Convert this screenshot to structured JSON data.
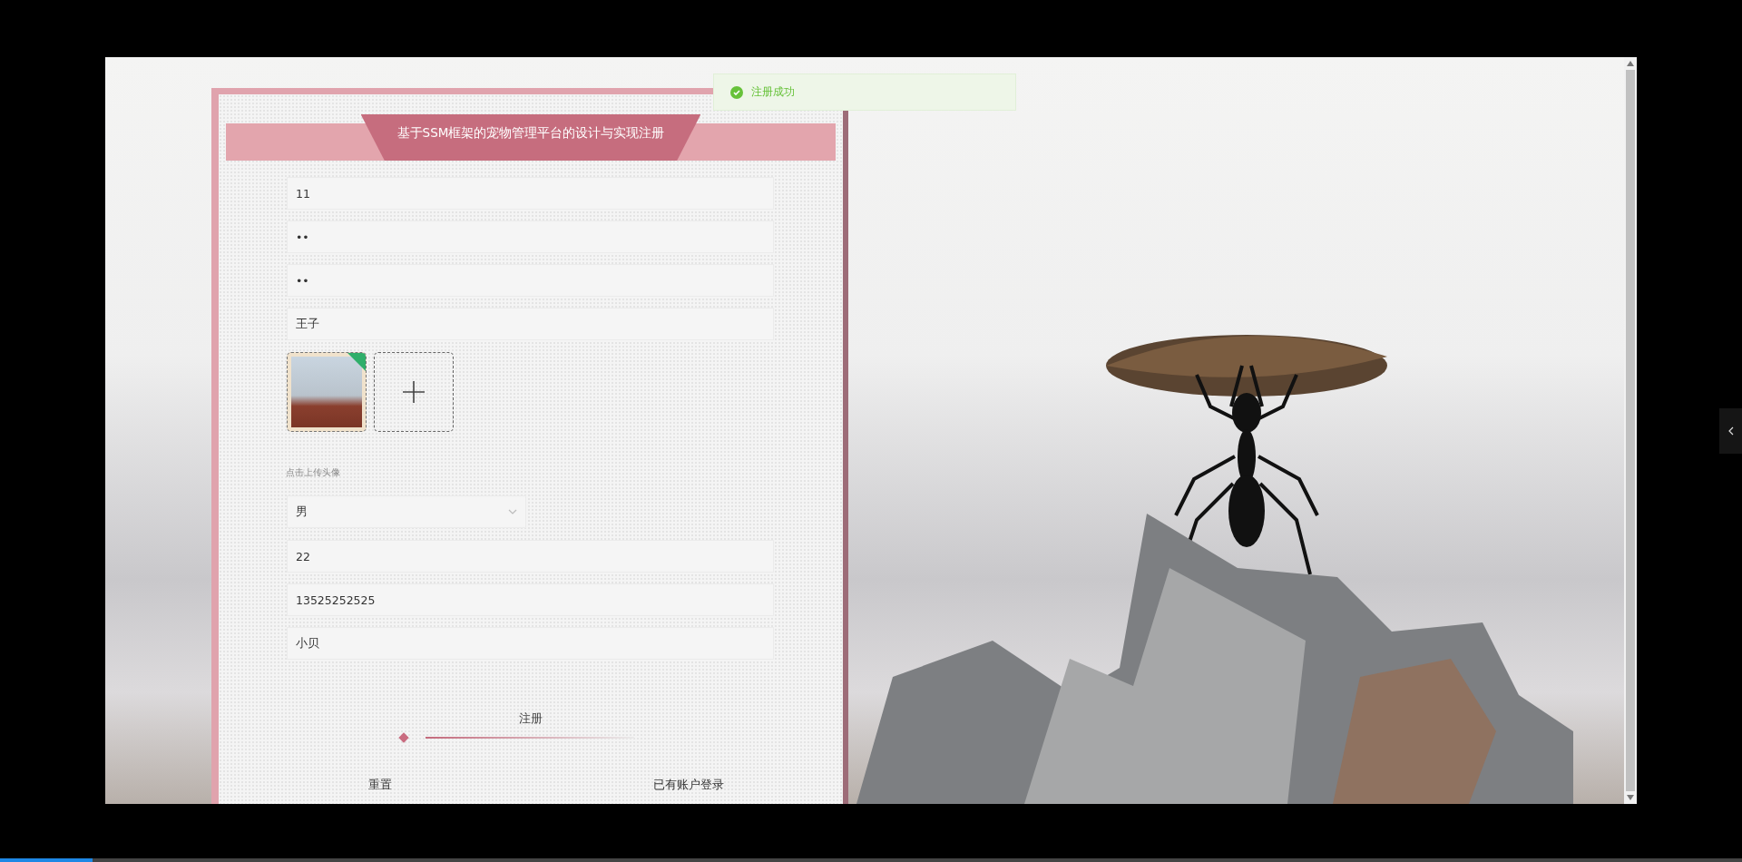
{
  "toast": {
    "message": "注册成功"
  },
  "title": "基于SSM框架的宠物管理平台的设计与实现注册",
  "items": [
    {
      "kind": "input",
      "value": "11"
    },
    {
      "kind": "input",
      "value": "••"
    },
    {
      "kind": "input",
      "value": "••"
    },
    {
      "kind": "input",
      "value": "王子"
    },
    {
      "kind": "upload",
      "files": [
        {
          "kind": "image",
          "uploaded": true
        },
        {
          "kind": "add"
        }
      ]
    },
    {
      "kind": "hint",
      "text": "点击上传头像"
    },
    {
      "kind": "select",
      "value": "男"
    },
    {
      "kind": "input",
      "value": "22"
    },
    {
      "kind": "input",
      "value": "13525252525"
    },
    {
      "kind": "input",
      "value": "小贝"
    }
  ],
  "register_button": "注册",
  "reset_button": "重置",
  "login_link": "已有账户登录",
  "player": {
    "level": 0.053
  }
}
